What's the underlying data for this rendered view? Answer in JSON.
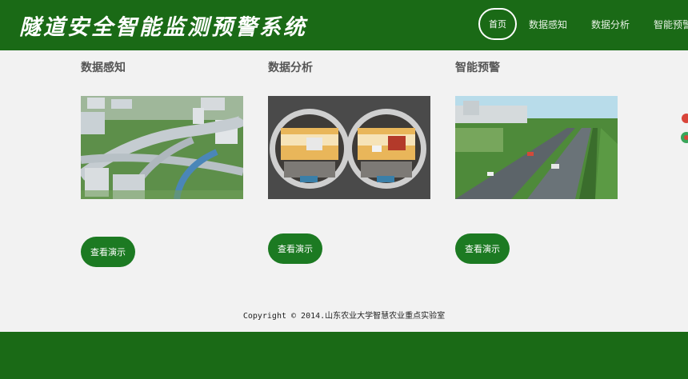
{
  "header": {
    "site_title": "隧道安全智能监测预警系统"
  },
  "nav": {
    "items": [
      "首页",
      "数据感知",
      "数据分析",
      "智能预警"
    ],
    "active_index": 0
  },
  "columns": [
    {
      "title": "数据感知",
      "image": "highway-interchange-photo",
      "button_label": "查看演示"
    },
    {
      "title": "数据分析",
      "image": "tunnel-cross-section-photo",
      "button_label": "查看演示"
    },
    {
      "title": "智能预警",
      "image": "road-tunnel-entrance-photo",
      "button_label": "查看演示"
    }
  ],
  "footer": {
    "copyright": "Copyright © 2014.山东农业大学智慧农业重点实验室"
  },
  "colors": {
    "header_bg": "#1a6a16",
    "button_bg": "#1c7a22",
    "page_bg": "#f2f2f2"
  }
}
